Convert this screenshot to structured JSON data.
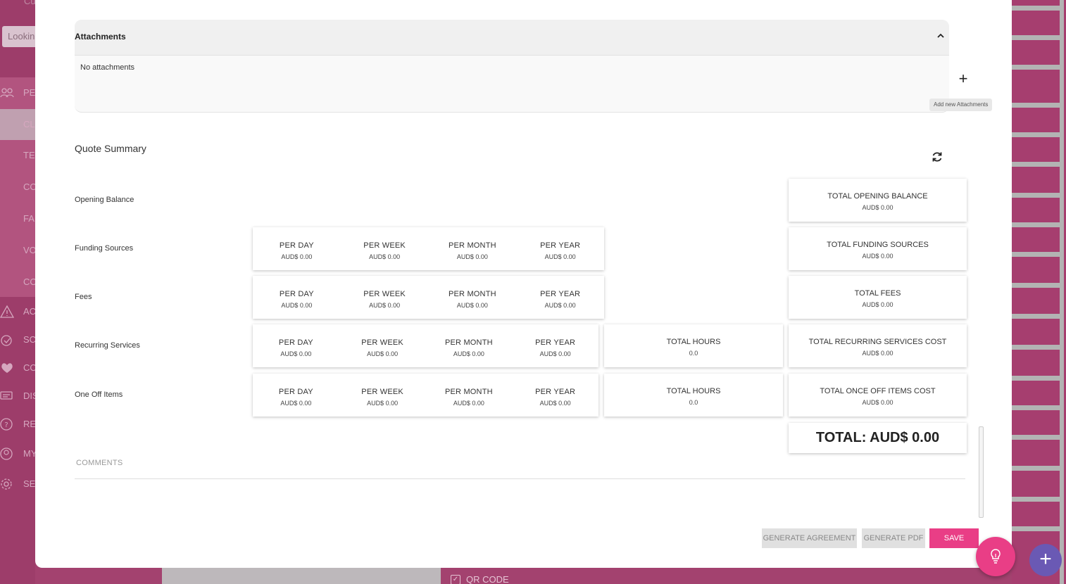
{
  "background": {
    "top_text": "Cu",
    "search_placeholder": "Lookin",
    "sidebar_items": [
      {
        "icon": "people-icon",
        "label": "PE"
      },
      {
        "icon": "",
        "label": "CL"
      },
      {
        "icon": "",
        "label": "TE"
      },
      {
        "icon": "",
        "label": "CO"
      },
      {
        "icon": "",
        "label": "FA"
      },
      {
        "icon": "",
        "label": "VO"
      },
      {
        "icon": "",
        "label": "CO"
      },
      {
        "icon": "alert-icon",
        "label": "AC"
      },
      {
        "icon": "clock-icon",
        "label": "SC"
      },
      {
        "icon": "heart-icon",
        "label": "CO"
      },
      {
        "icon": "chat-icon",
        "label": "DIS"
      },
      {
        "icon": "help-icon",
        "label": "RE"
      },
      {
        "icon": "user-icon",
        "label": "MY"
      },
      {
        "icon": "gear-icon",
        "label": "SE"
      }
    ],
    "qr_code_label": "QR CODE"
  },
  "attachments": {
    "title": "Attachments",
    "empty_text": "No attachments",
    "add_tooltip": "Add new Attachments",
    "add_symbol": "+"
  },
  "quote_summary": {
    "title": "Quote Summary",
    "rows": {
      "opening_balance": {
        "label": "Opening Balance",
        "total": {
          "heading": "TOTAL OPENING BALANCE",
          "value": "AUD$ 0.00"
        }
      },
      "funding_sources": {
        "label": "Funding Sources",
        "periods": [
          {
            "heading": "PER DAY",
            "value": "AUD$ 0.00"
          },
          {
            "heading": "PER WEEK",
            "value": "AUD$ 0.00"
          },
          {
            "heading": "PER MONTH",
            "value": "AUD$ 0.00"
          },
          {
            "heading": "PER YEAR",
            "value": "AUD$ 0.00"
          }
        ],
        "total": {
          "heading": "TOTAL FUNDING SOURCES",
          "value": "AUD$ 0.00"
        }
      },
      "fees": {
        "label": "Fees",
        "periods": [
          {
            "heading": "PER DAY",
            "value": "AUD$ 0.00"
          },
          {
            "heading": "PER WEEK",
            "value": "AUD$ 0.00"
          },
          {
            "heading": "PER MONTH",
            "value": "AUD$ 0.00"
          },
          {
            "heading": "PER YEAR",
            "value": "AUD$ 0.00"
          }
        ],
        "total": {
          "heading": "TOTAL FEES",
          "value": "AUD$ 0.00"
        }
      },
      "recurring_services": {
        "label": "Recurring Services",
        "periods": [
          {
            "heading": "PER DAY",
            "value": "AUD$ 0.00"
          },
          {
            "heading": "PER WEEK",
            "value": "AUD$ 0.00"
          },
          {
            "heading": "PER MONTH",
            "value": "AUD$ 0.00"
          },
          {
            "heading": "PER YEAR",
            "value": "AUD$ 0.00"
          }
        ],
        "hours": {
          "heading": "TOTAL HOURS",
          "value": "0.0"
        },
        "total": {
          "heading": "TOTAL RECURRING SERVICES COST",
          "value": "AUD$ 0.00"
        }
      },
      "one_off_items": {
        "label": "One Off Items",
        "periods": [
          {
            "heading": "PER DAY",
            "value": "AUD$ 0.00"
          },
          {
            "heading": "PER WEEK",
            "value": "AUD$ 0.00"
          },
          {
            "heading": "PER MONTH",
            "value": "AUD$ 0.00"
          },
          {
            "heading": "PER YEAR",
            "value": "AUD$ 0.00"
          }
        ],
        "hours": {
          "heading": "TOTAL HOURS",
          "value": "0.0"
        },
        "total": {
          "heading": "TOTAL ONCE OFF ITEMS COST",
          "value": "AUD$ 0.00"
        }
      }
    },
    "grand_total": "TOTAL: AUD$ 0.00"
  },
  "comments": {
    "placeholder": "COMMENTS"
  },
  "actions": {
    "generate_agreement": "GENERATE AGREEMENT",
    "generate_pdf": "GENERATE PDF",
    "save": "SAVE"
  },
  "fab": {
    "plus_symbol": "+"
  },
  "colors": {
    "accent": "#e93e86",
    "backdrop": "#a3426f",
    "fab_secondary": "#6a59b4"
  }
}
